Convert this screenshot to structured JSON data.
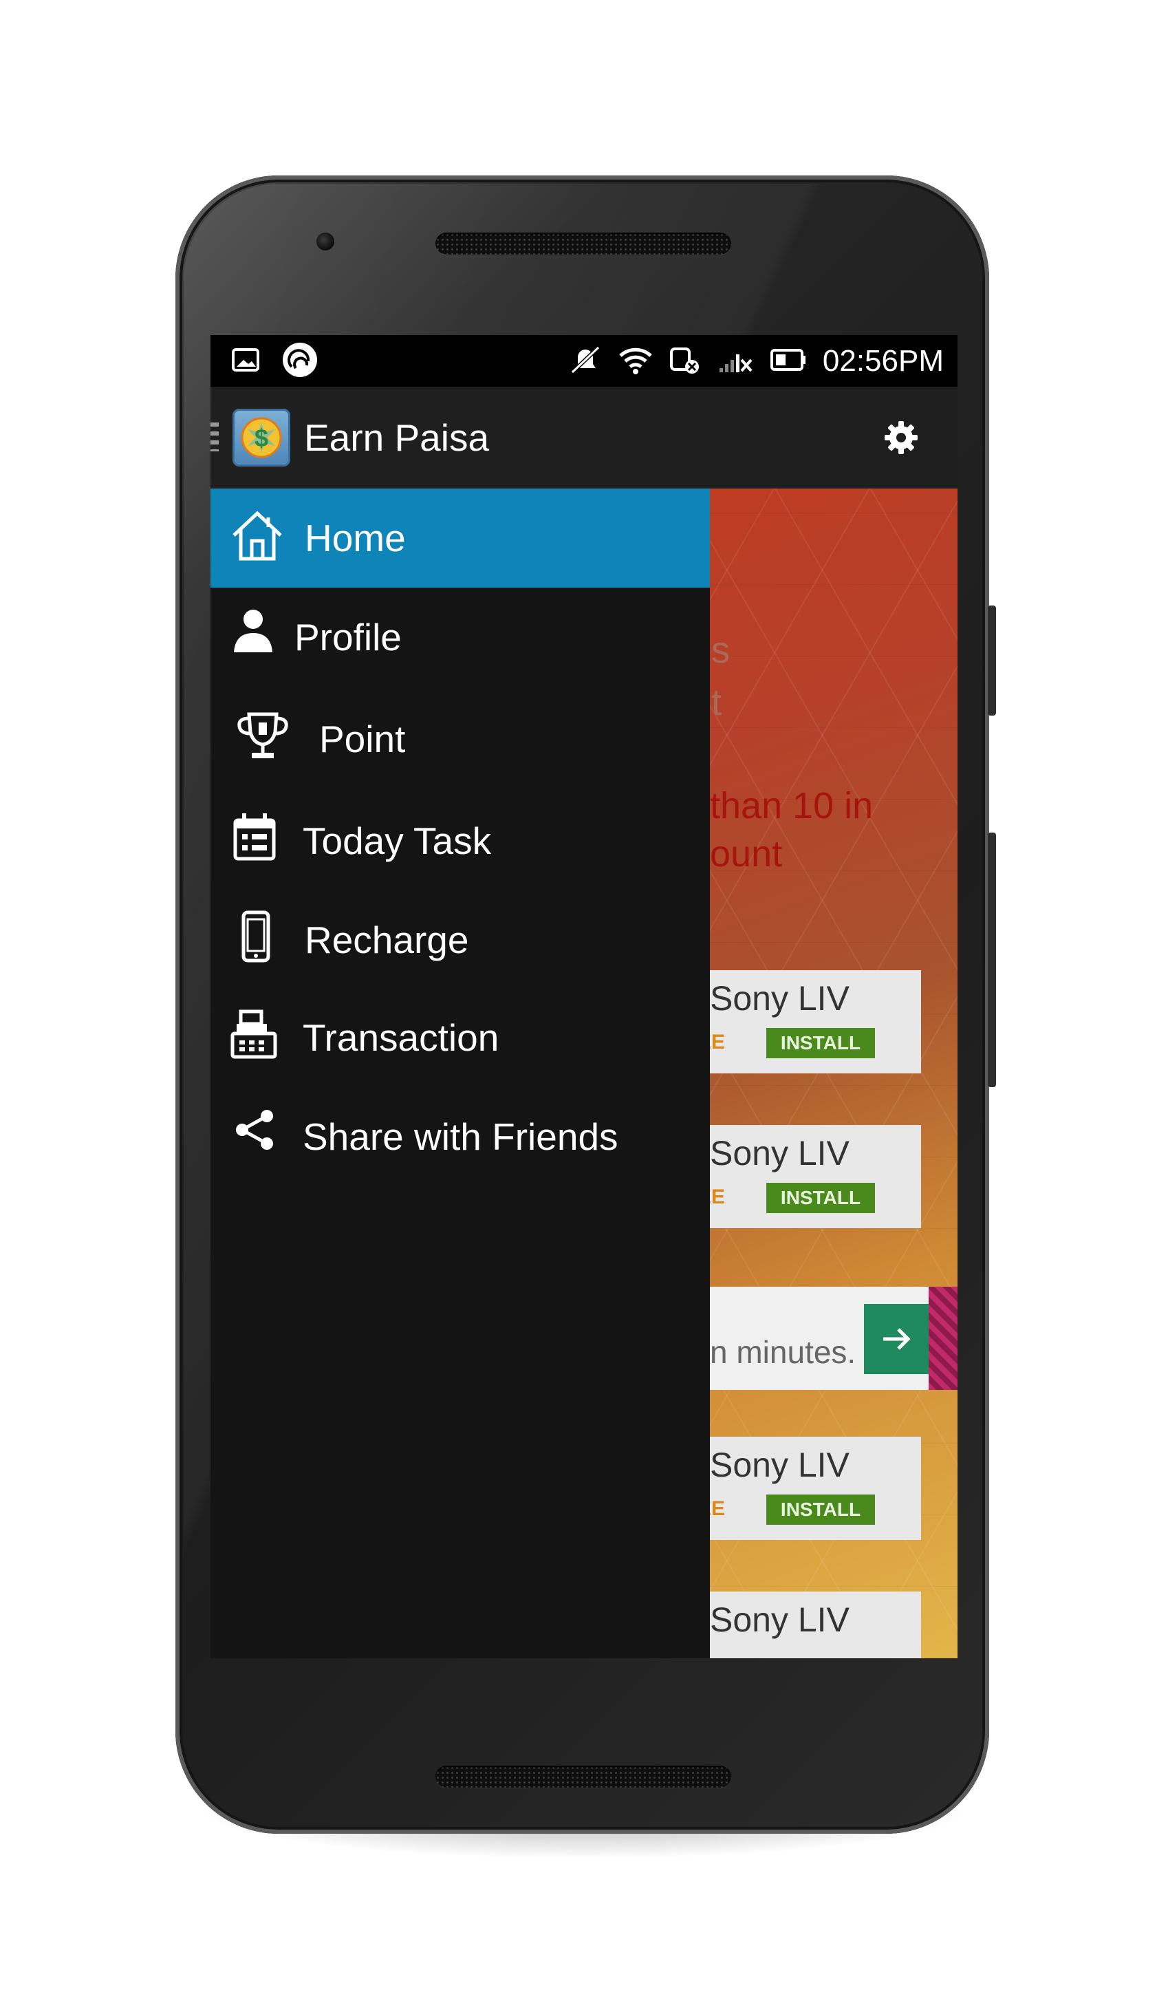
{
  "status_bar": {
    "time": "02:56PM",
    "icons": [
      "image-icon",
      "torrent-icon",
      "notifications-muted-icon",
      "wifi-icon",
      "data-off-icon",
      "signal-weak-icon",
      "battery-icon"
    ]
  },
  "app_bar": {
    "title": "Earn Paisa",
    "logo": "earn-paisa-logo",
    "settings_icon": "gear-icon"
  },
  "drawer": {
    "items": [
      {
        "label": "Home",
        "icon": "home-icon",
        "active": true
      },
      {
        "label": "Profile",
        "icon": "person-icon",
        "active": false
      },
      {
        "label": "Point",
        "icon": "trophy-icon",
        "active": false
      },
      {
        "label": "Today Task",
        "icon": "calendar-icon",
        "active": false
      },
      {
        "label": "Recharge",
        "icon": "mobile-phone-icon",
        "active": false
      },
      {
        "label": "Transaction",
        "icon": "cash-register-icon",
        "active": false
      },
      {
        "label": "Share with Friends",
        "icon": "share-icon",
        "active": false
      }
    ]
  },
  "background_content": {
    "partial_texts": [
      "s",
      "t"
    ],
    "warning_lines": [
      "than 10 in",
      "ount"
    ],
    "ads": [
      {
        "title": "Sony LIV",
        "price": "EE",
        "button": "INSTALL"
      },
      {
        "title": "Sony LIV",
        "price": "EE",
        "button": "INSTALL"
      },
      {
        "title": "Sony LIV",
        "price": "EE",
        "button": "INSTALL"
      },
      {
        "title": "Sony LIV",
        "price": "",
        "button": ""
      }
    ],
    "banner": {
      "text": "n minutes.",
      "icon": "arrow-right-icon"
    }
  },
  "colors": {
    "accent": "#0f84b8",
    "drawer_bg": "#141414",
    "appbar_bg": "#1f1f1f",
    "install_green": "#4a8a1c"
  }
}
